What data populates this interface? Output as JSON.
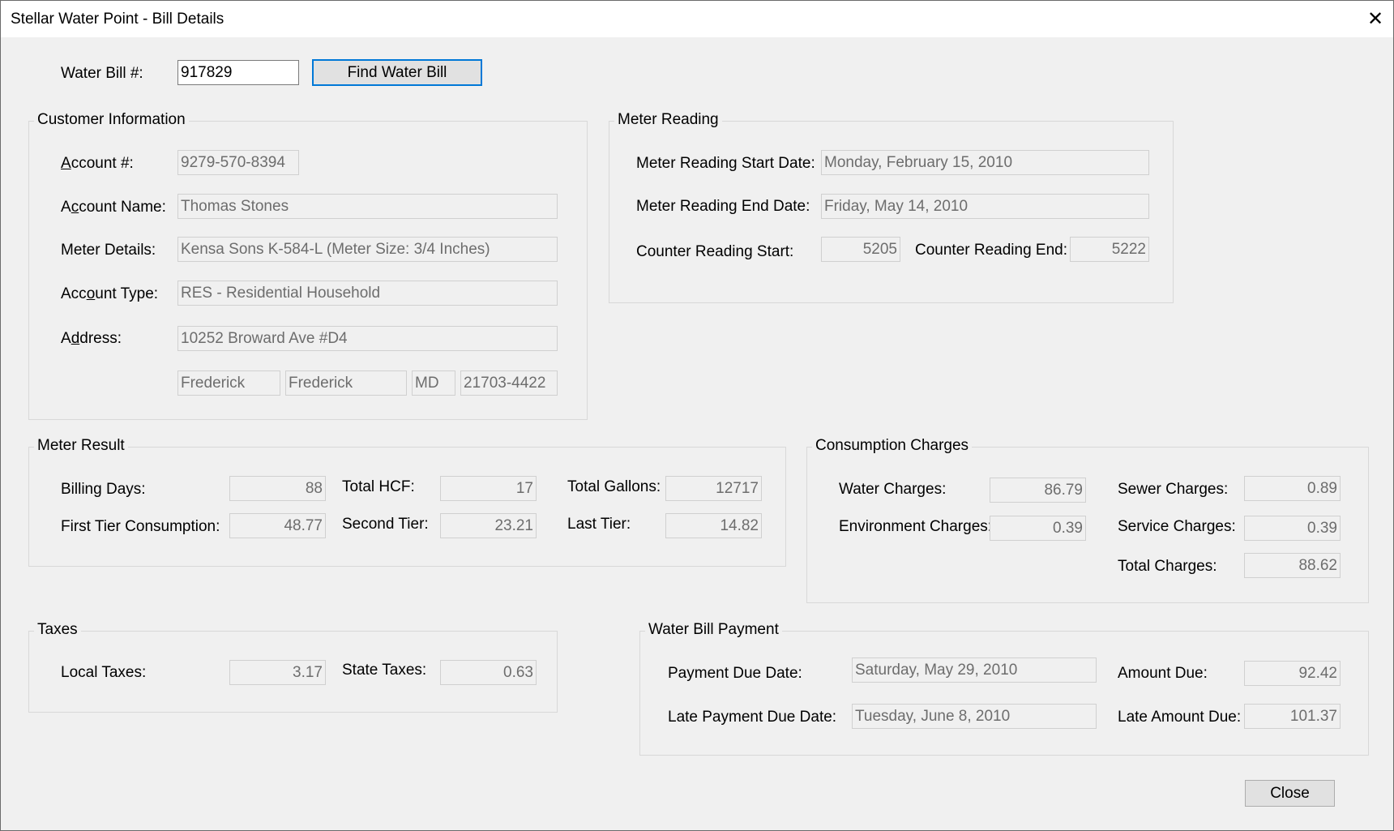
{
  "window": {
    "title": "Stellar Water Point - Bill Details",
    "close_glyph": "✕"
  },
  "search": {
    "label": "Water Bill #:",
    "value": "917829",
    "button_label": "Find Water Bill"
  },
  "customer": {
    "legend": "Customer Information",
    "account_label_pre": "",
    "account_label_ul": "A",
    "account_label_post": "ccount #:",
    "account_value": "9279-570-8394",
    "name_label_pre": "A",
    "name_label_ul": "c",
    "name_label_post": "count Name:",
    "name_value": "Thomas Stones",
    "meter_label": "Meter Details:",
    "meter_value": "Kensa Sons K-584-L (Meter Size: 3/4 Inches)",
    "type_label_pre": "Acc",
    "type_label_ul": "o",
    "type_label_post": "unt Type:",
    "type_value": "RES - Residential Household",
    "address_label_pre": "A",
    "address_label_ul": "d",
    "address_label_post": "dress:",
    "address_value": "10252 Broward Ave #D4",
    "city": "Frederick",
    "county": "Frederick",
    "state": "MD",
    "zip": "21703-4422"
  },
  "meter_reading": {
    "legend": "Meter Reading",
    "start_date_label": "Meter Reading Start Date:",
    "start_date": "Monday, February 15, 2010",
    "end_date_label": "Meter Reading End Date:",
    "end_date": "Friday, May 14, 2010",
    "counter_start_label": "Counter Reading Start:",
    "counter_start": "5205",
    "counter_end_label": "Counter Reading End:",
    "counter_end": "5222"
  },
  "meter_result": {
    "legend": "Meter Result",
    "billing_days_label": "Billing Days:",
    "billing_days": "88",
    "total_hcf_label": "Total HCF:",
    "total_hcf": "17",
    "total_gallons_label": "Total Gallons:",
    "total_gallons": "12717",
    "first_tier_label": "First Tier Consumption:",
    "first_tier": "48.77",
    "second_tier_label": "Second Tier:",
    "second_tier": "23.21",
    "last_tier_label": "Last Tier:",
    "last_tier": "14.82"
  },
  "consumption": {
    "legend": "Consumption Charges",
    "water_label": "Water Charges:",
    "water": "86.79",
    "sewer_label": "Sewer Charges:",
    "sewer": "0.89",
    "environment_label": "Environment Charges:",
    "environment": "0.39",
    "service_label": "Service Charges:",
    "service": "0.39",
    "total_label": "Total Charges:",
    "total": "88.62"
  },
  "taxes": {
    "legend": "Taxes",
    "local_label": "Local Taxes:",
    "local": "3.17",
    "state_label": "State Taxes:",
    "state": "0.63"
  },
  "payment": {
    "legend": "Water Bill Payment",
    "due_date_label": "Payment Due Date:",
    "due_date": "Saturday, May 29, 2010",
    "amount_due_label": "Amount Due:",
    "amount_due": "92.42",
    "late_date_label": "Late Payment Due Date:",
    "late_date": "Tuesday, June 8, 2010",
    "late_amount_label": "Late Amount Due:",
    "late_amount": "101.37"
  },
  "footer": {
    "close_label": "Close"
  }
}
